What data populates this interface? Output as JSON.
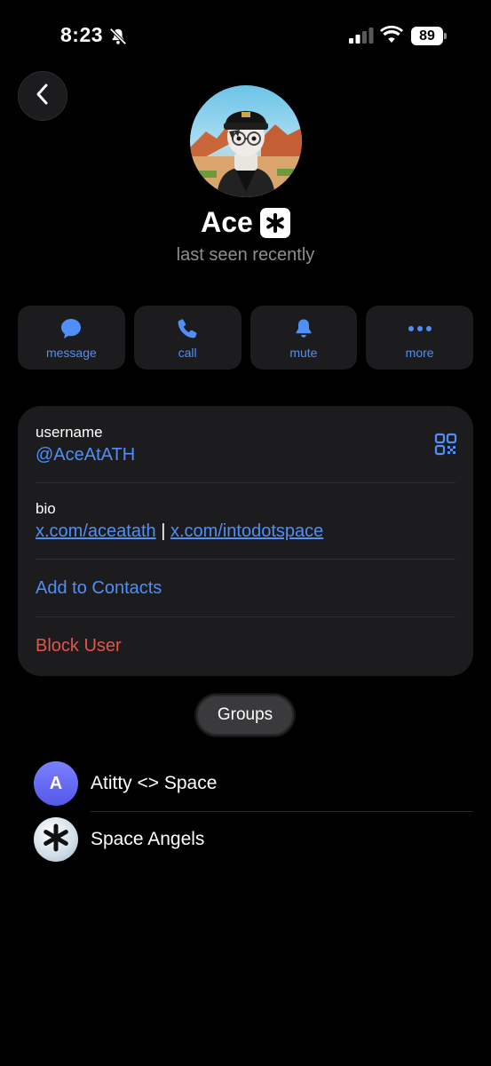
{
  "status_bar": {
    "time": "8:23",
    "battery": "89",
    "icons": [
      "bell-slash-icon",
      "signal-icon",
      "wifi-icon",
      "battery-icon"
    ]
  },
  "profile": {
    "name": "Ace",
    "status": "last seen recently"
  },
  "actions": [
    {
      "label": "message",
      "icon": "message-bubble-icon"
    },
    {
      "label": "call",
      "icon": "phone-icon"
    },
    {
      "label": "mute",
      "icon": "bell-icon"
    },
    {
      "label": "more",
      "icon": "ellipsis-icon"
    }
  ],
  "info": {
    "username_label": "username",
    "username": "@AceAtATH",
    "bio_label": "bio",
    "bio_link_1": "x.com/aceatath",
    "bio_separator": "|",
    "bio_link_2": "x.com/intodotspace",
    "add_contacts": "Add to Contacts",
    "block_user": "Block User"
  },
  "groups_tab": "Groups",
  "groups": [
    {
      "name": "Atitty <> Space",
      "avatar_letter": "A"
    },
    {
      "name": "Space Angels",
      "avatar_letter": ""
    }
  ],
  "colors": {
    "accent": "#4f8ff7",
    "danger": "#e5544b",
    "card": "#1c1c1e",
    "background": "#000000"
  }
}
